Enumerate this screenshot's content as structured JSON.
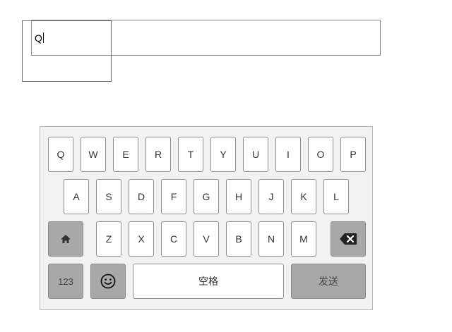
{
  "input": {
    "value": "Q"
  },
  "keyboard": {
    "row1": [
      "Q",
      "W",
      "E",
      "R",
      "T",
      "Y",
      "U",
      "I",
      "O",
      "P"
    ],
    "row2": [
      "A",
      "S",
      "D",
      "F",
      "G",
      "H",
      "J",
      "K",
      "L"
    ],
    "row3": [
      "Z",
      "X",
      "C",
      "V",
      "B",
      "N",
      "M"
    ],
    "numbers_label": "123",
    "space_label": "空格",
    "send_label": "发送",
    "shift_icon": "home-icon",
    "backspace_icon": "backspace-icon",
    "emoji_icon": "smiley-icon"
  },
  "colors": {
    "highlight_border": "#e03a3a",
    "function_key": "#a8a8a8",
    "keyboard_bg": "#f2f2f2"
  }
}
